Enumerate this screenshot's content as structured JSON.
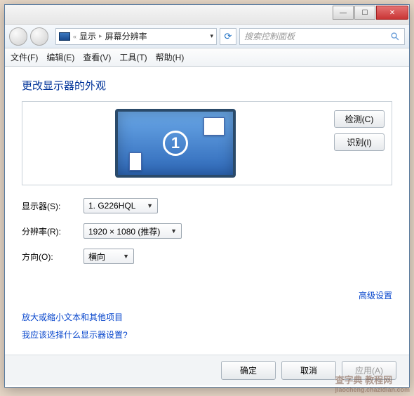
{
  "titlebar": {
    "min": "—",
    "max": "☐",
    "close": "✕"
  },
  "nav": {
    "crumb_back": "«",
    "crumb_root": "显示",
    "crumb_sep": "▸",
    "crumb_here": "屏幕分辨率",
    "dropdown": "▾",
    "refresh": "⟳",
    "search_placeholder": "搜索控制面板"
  },
  "menu": {
    "file": "文件(F)",
    "edit": "编辑(E)",
    "view": "查看(V)",
    "tools": "工具(T)",
    "help": "帮助(H)"
  },
  "heading": "更改显示器的外观",
  "monitor_number": "1",
  "buttons": {
    "detect": "检测(C)",
    "identify": "识别(I)"
  },
  "labels": {
    "monitor": "显示器(S):",
    "resolution": "分辨率(R):",
    "orientation": "方向(O):"
  },
  "values": {
    "monitor": "1. G226HQL",
    "resolution": "1920 × 1080 (推荐)",
    "orientation": "横向"
  },
  "links": {
    "advanced": "高级设置",
    "scale": "放大或缩小文本和其他项目",
    "help": "我应该选择什么显示器设置?"
  },
  "footer": {
    "ok": "确定",
    "cancel": "取消",
    "apply": "应用(A)"
  },
  "watermark": {
    "main": "查字典 教程网",
    "sub": "jiaocheng.chazidian.com"
  }
}
